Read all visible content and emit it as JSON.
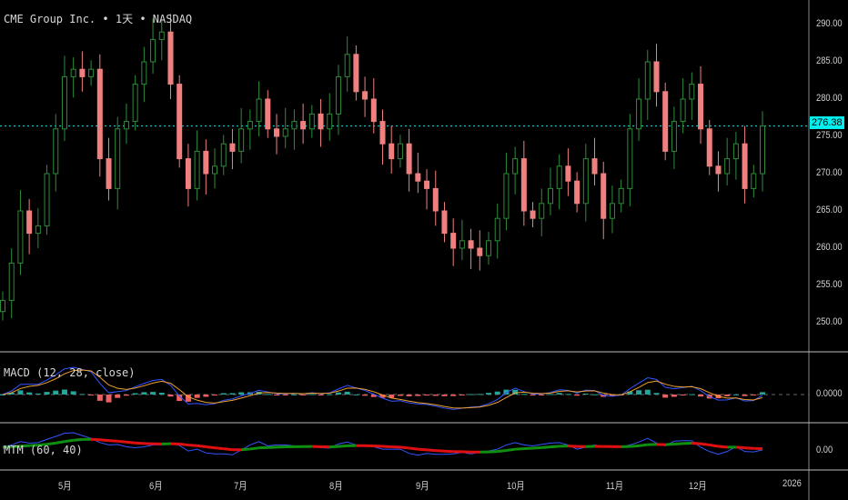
{
  "header": {
    "symbol": "CME Group Inc.",
    "interval": "1天",
    "exchange": "NASDAQ",
    "sep": "•"
  },
  "colors": {
    "up": "#2e8b3a",
    "down": "#f08080",
    "macd": "#3355ff",
    "signal": "#f0a030",
    "last": "#00f0f0",
    "mtm_line": "#3355ff",
    "ma_up": "#109010",
    "ma_down": "#e01010"
  },
  "indicators": {
    "macd_label": "MACD (12, 28, close)",
    "macd_zero": "0.0000",
    "mtm_label": "MTM (60, 40)",
    "mtm_zero": "0.00"
  },
  "chart_data": {
    "type": "candlestick",
    "title": "CME Group Inc. • 1天 • NASDAQ",
    "ylim": [
      247,
      292
    ],
    "y_ticks": [
      "290.00",
      "285.00",
      "280.00",
      "275.00",
      "270.00",
      "265.00",
      "260.00",
      "255.00",
      "250.00"
    ],
    "x_ticks": [
      "5月",
      "6月",
      "7月",
      "8月",
      "9月",
      "10月",
      "11月",
      "12月",
      "2026"
    ],
    "last_price": "276.38",
    "closes": [
      253,
      258,
      265,
      262,
      263,
      270,
      276,
      283,
      284,
      283,
      284,
      272,
      268,
      276,
      277,
      282,
      285,
      288,
      289,
      282,
      272,
      268,
      273,
      270,
      271,
      274,
      273,
      276,
      277,
      280,
      276,
      275,
      276,
      277,
      276,
      278,
      276,
      278,
      283,
      286,
      281,
      280,
      277,
      274,
      272,
      274,
      270,
      269,
      268,
      265,
      262,
      260,
      261,
      260,
      259,
      261,
      264,
      270,
      272,
      265,
      264,
      266,
      268,
      271,
      269,
      266,
      272,
      270,
      264,
      266,
      268,
      276,
      280,
      285,
      281,
      273,
      277,
      280,
      282,
      276,
      271,
      270,
      272,
      274,
      268,
      270,
      276.38
    ]
  }
}
